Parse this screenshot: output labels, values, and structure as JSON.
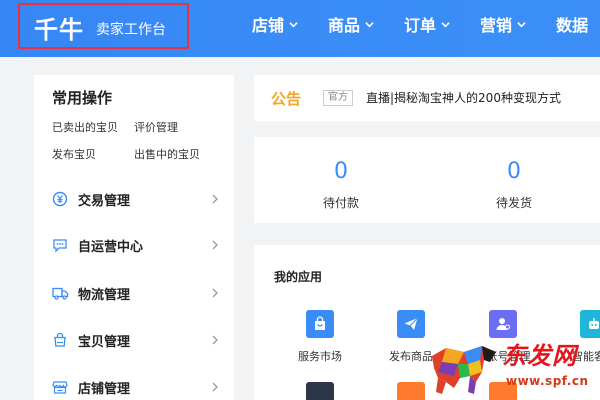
{
  "header": {
    "logo": "千牛",
    "subtitle": "卖家工作台",
    "nav": [
      "店铺",
      "商品",
      "订单",
      "营销",
      "数据"
    ]
  },
  "left_panel": {
    "title": "常用操作",
    "quick_links": [
      "已卖出的宝贝",
      "评价管理",
      "发布宝贝",
      "出售中的宝贝"
    ],
    "menu": [
      {
        "label": "交易管理",
        "icon": "yuan-icon"
      },
      {
        "label": "自运营中心",
        "icon": "chat-icon"
      },
      {
        "label": "物流管理",
        "icon": "truck-icon"
      },
      {
        "label": "宝贝管理",
        "icon": "bag-icon"
      },
      {
        "label": "店铺管理",
        "icon": "store-icon"
      }
    ]
  },
  "notice": {
    "label": "公告",
    "tag": "官方",
    "text": "直播|揭秘淘宝神人的200种变现方式"
  },
  "stats": [
    {
      "value": "0",
      "label": "待付款"
    },
    {
      "value": "0",
      "label": "待发货"
    }
  ],
  "apps": {
    "title": "我的应用",
    "items": [
      {
        "label": "服务市场",
        "icon": "shopping-bag-icon",
        "color": "#3a8cf6"
      },
      {
        "label": "发布商品",
        "icon": "paper-plane-icon",
        "color": "#3a8cf6"
      },
      {
        "label": "子账号管理",
        "icon": "user-settings-icon",
        "color": "#6b6ef2"
      },
      {
        "label": "智能客服",
        "icon": "robot-icon",
        "color": "#1fb6d9"
      }
    ]
  },
  "watermark": {
    "title": "东发网",
    "url": "www.spf.cn"
  },
  "colors": {
    "header": "#3a8cf6",
    "accent_orange": "#f5a623",
    "stat_blue": "#3a8cf6",
    "highlight_box": "#e8323c"
  }
}
